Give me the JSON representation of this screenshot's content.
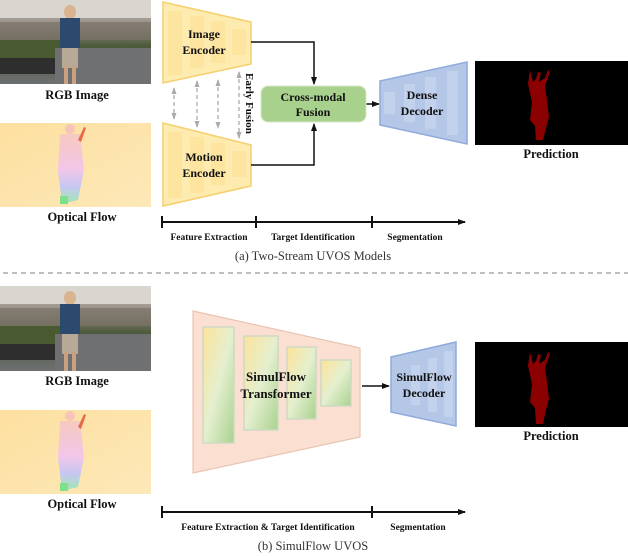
{
  "panel_a": {
    "inputs": {
      "rgb_label": "RGB Image",
      "flow_label": "Optical Flow"
    },
    "image_encoder": [
      "Image",
      "Encoder"
    ],
    "motion_encoder": [
      "Motion",
      "Encoder"
    ],
    "early_fusion": "Early Fusion",
    "cross_modal_fusion": [
      "Cross-modal",
      "Fusion"
    ],
    "dense_decoder": [
      "Dense",
      "Decoder"
    ],
    "prediction_label": "Prediction",
    "timeline": [
      "Feature Extraction",
      "Target Identification",
      "Segmentation"
    ],
    "caption": "(a) Two-Stream UVOS Models"
  },
  "panel_b": {
    "inputs": {
      "rgb_label": "RGB Image",
      "flow_label": "Optical Flow"
    },
    "transformer": [
      "SimulFlow",
      "Transformer"
    ],
    "decoder": [
      "SimulFlow",
      "Decoder"
    ],
    "prediction_label": "Prediction",
    "timeline": [
      "Feature Extraction & Target Identification",
      "Segmentation"
    ],
    "caption": "(b) SimulFlow UVOS"
  },
  "colors": {
    "encoder_fill": "#fdebb0",
    "encoder_stroke": "#f6cf6e",
    "fusion_fill": "#a9d18e",
    "decoder_fill": "#b4c7e7",
    "decoder_stroke": "#8faadc",
    "transformer_fill": "#fbe0d2",
    "mask": "#8b0000",
    "flow_bg": "#fde3a8"
  }
}
